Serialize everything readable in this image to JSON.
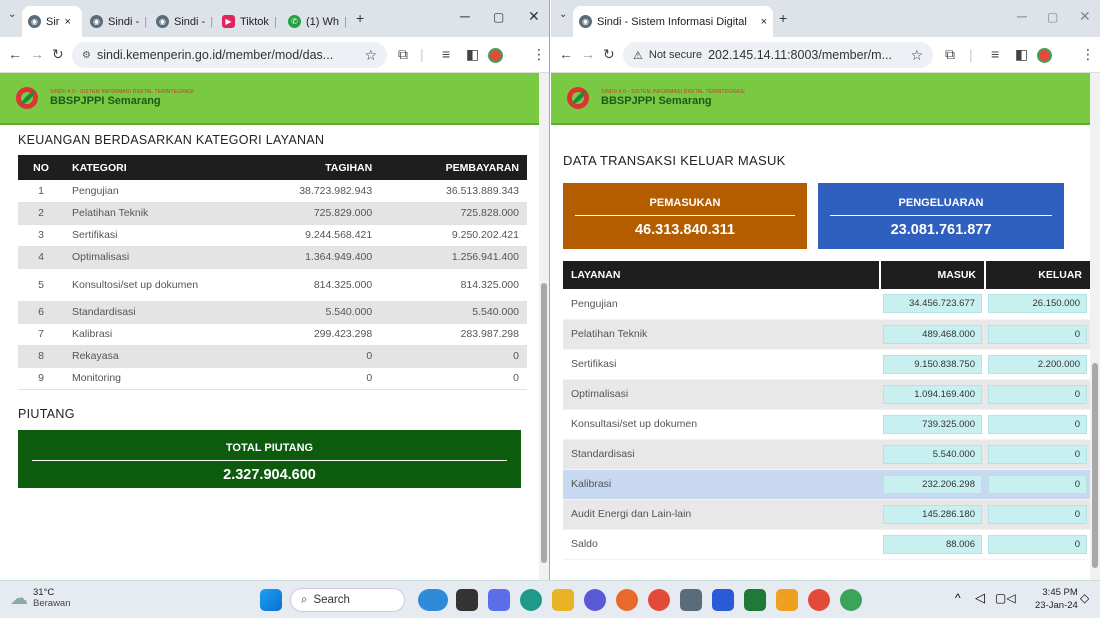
{
  "left": {
    "tabs": [
      {
        "label": "Sir",
        "close": "×"
      },
      {
        "label": "Sindi -",
        "close": "|"
      },
      {
        "label": "Sindi -",
        "close": "|"
      },
      {
        "label": "Tiktok",
        "close": "|"
      },
      {
        "label": "(1) Wh",
        "close": "|"
      }
    ],
    "new_tab": "+",
    "url": "sindi.kemenperin.go.id/member/mod/das...",
    "header": {
      "tagline": "SINDII 4.0 - SISTEM INFORMASI DIGITAL TERINTEGRASI",
      "org": "BBSPJPPI Semarang"
    },
    "section_title": "KEUANGAN BERDASARKAN KATEGORI LAYANAN",
    "columns": [
      "NO",
      "KATEGORI",
      "TAGIHAN",
      "PEMBAYARAN"
    ],
    "rows": [
      {
        "no": "1",
        "kategori": "Pengujian",
        "tagihan": "38.723.982.943",
        "pembayaran": "36.513.889.343"
      },
      {
        "no": "2",
        "kategori": "Pelatihan Teknik",
        "tagihan": "725.829.000",
        "pembayaran": "725.828.000"
      },
      {
        "no": "3",
        "kategori": "Sertifikasi",
        "tagihan": "9.244.568.421",
        "pembayaran": "9.250.202.421"
      },
      {
        "no": "4",
        "kategori": "Optimalisasi",
        "tagihan": "1.364.949.400",
        "pembayaran": "1.256.941.400"
      },
      {
        "no": "5",
        "kategori": "Konsultosi/set up dokumen",
        "tagihan": "814.325.000",
        "pembayaran": "814.325.000"
      },
      {
        "no": "6",
        "kategori": "Standardisasi",
        "tagihan": "5.540.000",
        "pembayaran": "5.540.000"
      },
      {
        "no": "7",
        "kategori": "Kalibrasi",
        "tagihan": "299.423.298",
        "pembayaran": "283.987.298"
      },
      {
        "no": "8",
        "kategori": "Rekayasa",
        "tagihan": "0",
        "pembayaran": "0"
      },
      {
        "no": "9",
        "kategori": "Monitoring",
        "tagihan": "0",
        "pembayaran": "0"
      }
    ],
    "piutang_title": "PIUTANG",
    "total_label": "TOTAL PIUTANG",
    "total_value": "2.327.904.600"
  },
  "right": {
    "tab_label": "Sindi - Sistem Informasi Digital",
    "tab_close": "×",
    "new_tab": "+",
    "not_secure": "Not secure",
    "url": "202.145.14.11:8003/member/m...",
    "header": {
      "tagline": "SINDII 4.0 - SISTEM INFORMASI DIGITAL TERINTEGRASI",
      "org": "BBSPJPPI Semarang"
    },
    "section_title": "DATA TRANSAKSI KELUAR MASUK",
    "pemasukan_label": "PEMASUKAN",
    "pemasukan_value": "46.313.840.311",
    "pengeluaran_label": "PENGELUARAN",
    "pengeluaran_value": "23.081.761.877",
    "columns": [
      "LAYANAN",
      "MASUK",
      "KELUAR"
    ],
    "rows": [
      {
        "layanan": "Pengujian",
        "masuk": "34.456.723.677",
        "keluar": "26.150.000"
      },
      {
        "layanan": "Pelatihan Teknik",
        "masuk": "489.468.000",
        "keluar": "0"
      },
      {
        "layanan": "Sertifikasi",
        "masuk": "9.150.838.750",
        "keluar": "2.200.000"
      },
      {
        "layanan": "Optimalisasi",
        "masuk": "1.094.169.400",
        "keluar": "0"
      },
      {
        "layanan": "Konsultasi/set up dokumen",
        "masuk": "739.325.000",
        "keluar": "0"
      },
      {
        "layanan": "Standardisasi",
        "masuk": "5.540.000",
        "keluar": "0"
      },
      {
        "layanan": "Kalibrasi",
        "masuk": "232.206.298",
        "keluar": "0"
      },
      {
        "layanan": "Audit Energi dan Lain-lain",
        "masuk": "145.286.180",
        "keluar": "0"
      },
      {
        "layanan": "Saldo",
        "masuk": "88.006",
        "keluar": "0"
      }
    ]
  },
  "taskbar": {
    "temp": "31°C",
    "weather": "Berawan",
    "search": "Search",
    "time": "3:45 PM",
    "date": "23-Jan-24"
  },
  "colors": {
    "green_header": "#7ac943",
    "piutang": "#0d5c0d",
    "pemasukan": "#b35c00",
    "pengeluaran": "#2f5fbf",
    "table_header": "#1e1e1e",
    "cell_cyan": "#c9f0f0"
  },
  "icons": [
    "chrome-icon",
    "tiktok-icon",
    "whatsapp-icon",
    "star-icon",
    "extensions-icon",
    "reading-list-icon",
    "sidepanel-icon",
    "profile-icon",
    "menu-icon",
    "windows-icon",
    "search-icon"
  ]
}
